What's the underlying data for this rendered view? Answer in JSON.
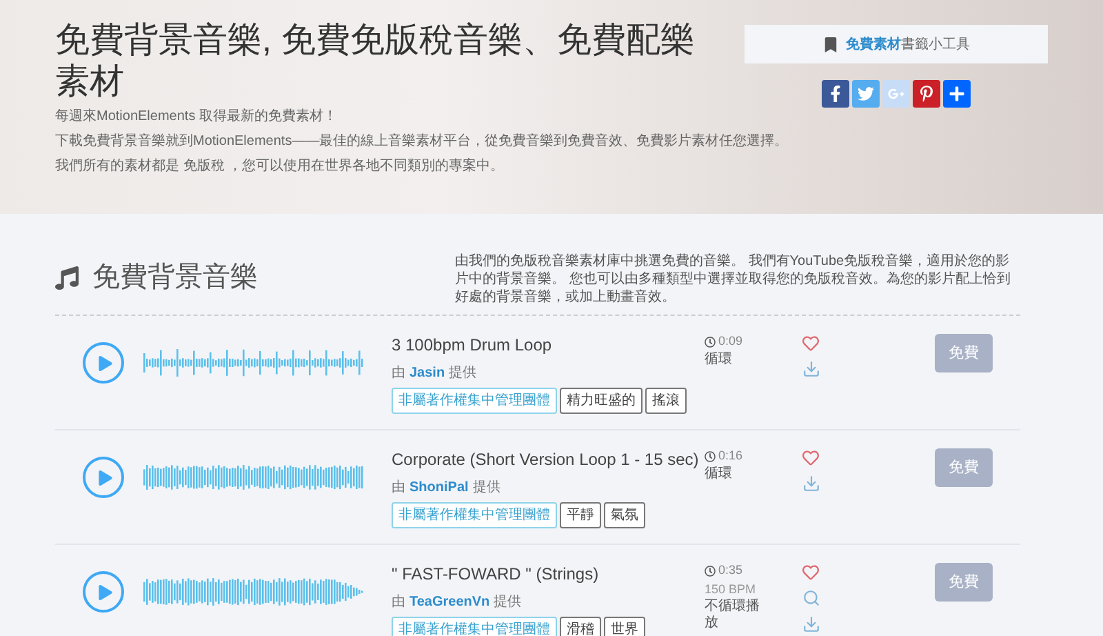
{
  "header": {
    "title": "免費背景音樂, 免費免版稅音樂、免費配樂素材",
    "paragraphs": [
      "每週來MotionElements 取得最新的免費素材！",
      "下載免費背景音樂就到MotionElements——最佳的線上音樂素材平台，從免費音樂到免費音效、免費影片素材任您選擇。",
      "我們所有的素材都是 免版稅 ，您可以使用在世界各地不同類別的專案中。"
    ],
    "bookmark": {
      "link": "免費素材",
      "text": "書籤小工具"
    },
    "share": [
      {
        "kind": "facebook"
      },
      {
        "kind": "twitter"
      },
      {
        "kind": "google"
      },
      {
        "kind": "pinterest"
      },
      {
        "kind": "more"
      }
    ]
  },
  "section": {
    "title": "免費背景音樂",
    "description": "由我們的免版稅音樂素材庫中挑選免費的音樂。 我們有YouTube免版稅音樂，適用於您的影片中的背景音樂。 您也可以由多種類型中選擇並取得您的免版稅音效。為您的影片配上恰到好處的背景音樂，或加上動畫音效。"
  },
  "tracks": [
    {
      "kind": "loop",
      "title": "3 100bpm Drum Loop",
      "by": "由",
      "author": "Jasin",
      "credit": "提供",
      "tags": [
        {
          "text": "非屬著作權集中管理團體",
          "kind": "license"
        },
        {
          "text": "精力旺盛的",
          "kind": "genre"
        },
        {
          "text": "搖滾",
          "kind": "genre"
        }
      ],
      "duration": "0:09",
      "loop": "循環",
      "button": "免費"
    },
    {
      "kind": "loop",
      "title": "Corporate (Short Version Loop 1 - 15 sec)",
      "by": "由",
      "author": "ShoniPal",
      "credit": "提供",
      "tags": [
        {
          "text": "非屬著作權集中管理團體",
          "kind": "license"
        },
        {
          "text": "平靜",
          "kind": "genre"
        },
        {
          "text": "氣氛",
          "kind": "genre"
        }
      ],
      "duration": "0:16",
      "loop": "循環",
      "button": "免費"
    },
    {
      "kind": "non_loop",
      "title": "\" FAST-FOWARD \" (Strings)",
      "by": "由",
      "author": "TeaGreenVn",
      "credit": "提供",
      "tags": [
        {
          "text": "非屬著作權集中管理團體",
          "kind": "license"
        },
        {
          "text": "滑稽",
          "kind": "genre"
        },
        {
          "text": "世界",
          "kind": "genre"
        }
      ],
      "duration": "0:35",
      "bpm": "150 BPM",
      "loop": "不循環播放",
      "button": "免費"
    }
  ]
}
